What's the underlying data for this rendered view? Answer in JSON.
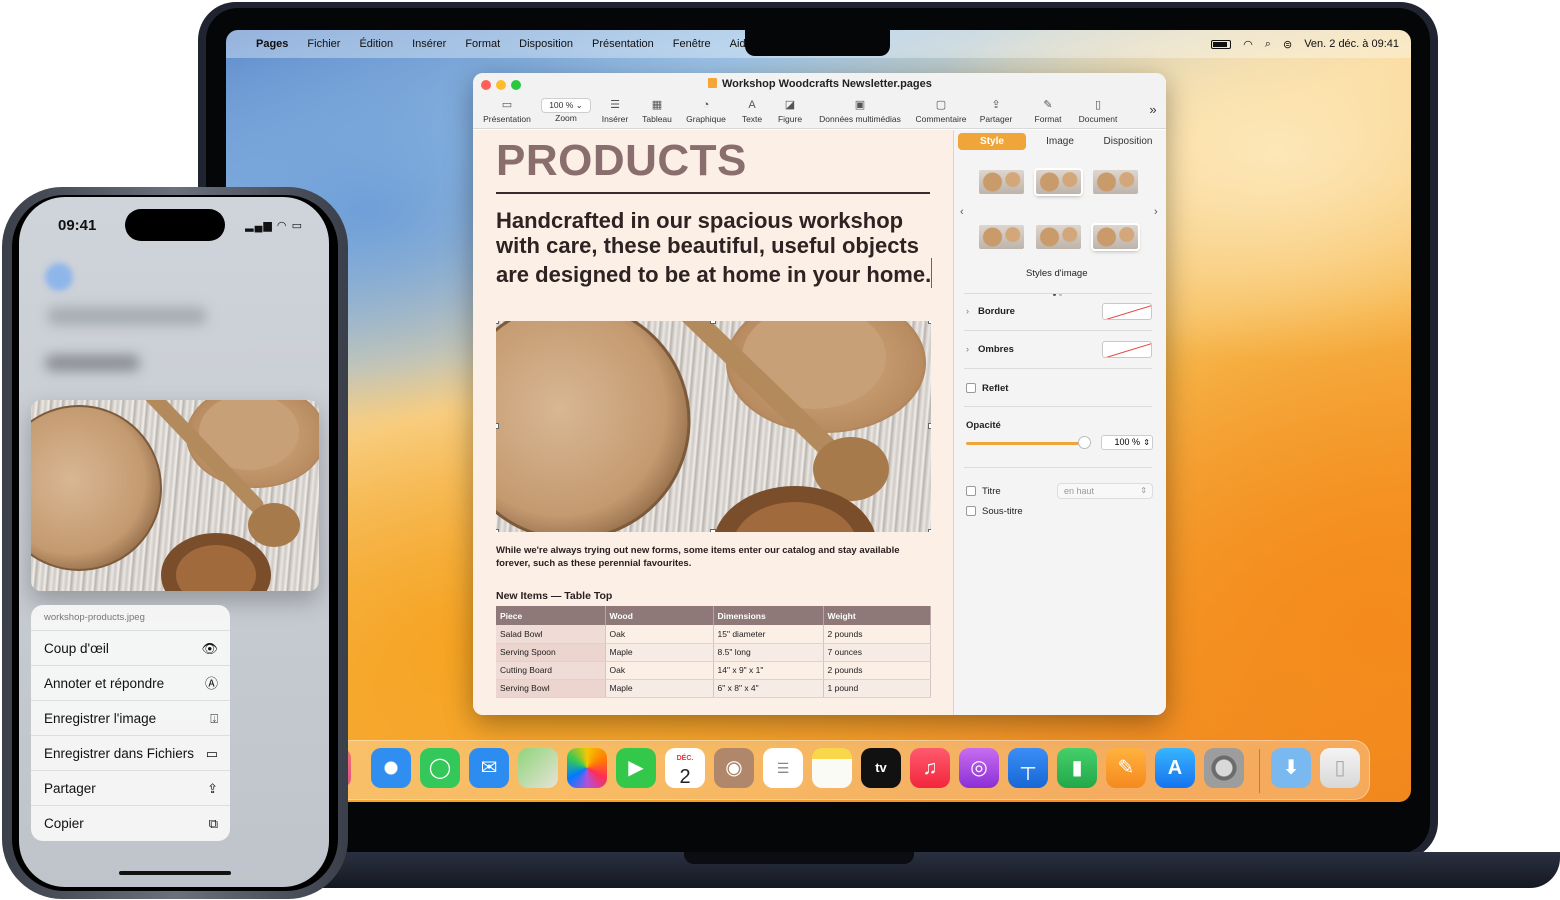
{
  "macos": {
    "menubar": {
      "app_name": "Pages",
      "items": [
        "Fichier",
        "Édition",
        "Insérer",
        "Format",
        "Disposition",
        "Présentation",
        "Fenêtre",
        "Aide"
      ],
      "datetime": "Ven. 2 déc. à 09:41"
    },
    "window": {
      "title": "Workshop Woodcrafts Newsletter.pages",
      "toolbar": {
        "zoom_value": "100 %",
        "items": [
          "Présentation",
          "Zoom",
          "Insérer",
          "Tableau",
          "Graphique",
          "Texte",
          "Figure",
          "Données multimédias",
          "Commentaire",
          "Partager",
          "Format",
          "Document"
        ]
      },
      "document": {
        "title": "PRODUCTS",
        "lead": "Handcrafted in our spacious workshop with care, these beautiful, useful objects are designed to be at home in your home.",
        "body": "While we're always trying out new forms, some items enter our catalog and stay available forever, such as these perennial favourites.",
        "table_title": "New Items — Table Top",
        "table": {
          "headers": [
            "Piece",
            "Wood",
            "Dimensions",
            "Weight"
          ],
          "rows": [
            [
              "Salad Bowl",
              "Oak",
              "15\" diameter",
              "2 pounds"
            ],
            [
              "Serving Spoon",
              "Maple",
              "8.5\" long",
              "7 ounces"
            ],
            [
              "Cutting Board",
              "Oak",
              "14\" x 9\" x 1\"",
              "2 pounds"
            ],
            [
              "Serving Bowl",
              "Maple",
              "6\" x 8\" x 4\"",
              "1 pound"
            ]
          ]
        }
      },
      "inspector": {
        "tabs": [
          "Style",
          "Image",
          "Disposition"
        ],
        "image_styles_label": "Styles d'image",
        "border_label": "Bordure",
        "shadow_label": "Ombres",
        "reflection_label": "Reflet",
        "opacity_label": "Opacité",
        "opacity_value": "100 %",
        "opacity_fraction": 1.0,
        "caption_label": "Titre",
        "caption_position": "en haut",
        "subtitle_label": "Sous-titre"
      }
    },
    "dock": {
      "calendar_month": "DÉC.",
      "calendar_day": "2",
      "apps": [
        "launchpad-icon",
        "safari-icon",
        "messages-icon",
        "mail-icon",
        "maps-icon",
        "photos-icon",
        "facetime-icon",
        "calendar-icon",
        "contacts-icon",
        "reminders-icon",
        "notes-icon",
        "tv-icon",
        "music-icon",
        "podcasts-icon",
        "keynote-icon",
        "numbers-icon",
        "pages-icon",
        "app-store-icon",
        "system-settings-icon",
        "downloads-folder-icon",
        "trash-icon"
      ]
    },
    "accent_color": "#f0a53a"
  },
  "iphone": {
    "time": "09:41",
    "menu": {
      "filename": "workshop-products.jpeg",
      "items": [
        {
          "label": "Coup d'œil",
          "icon": "eye-icon"
        },
        {
          "label": "Annoter et répondre",
          "icon": "markup-icon"
        },
        {
          "label": "Enregistrer l'image",
          "icon": "save-image-icon"
        },
        {
          "label": "Enregistrer dans Fichiers",
          "icon": "folder-icon"
        },
        {
          "label": "Partager",
          "icon": "share-icon"
        },
        {
          "label": "Copier",
          "icon": "copy-icon"
        }
      ]
    }
  }
}
